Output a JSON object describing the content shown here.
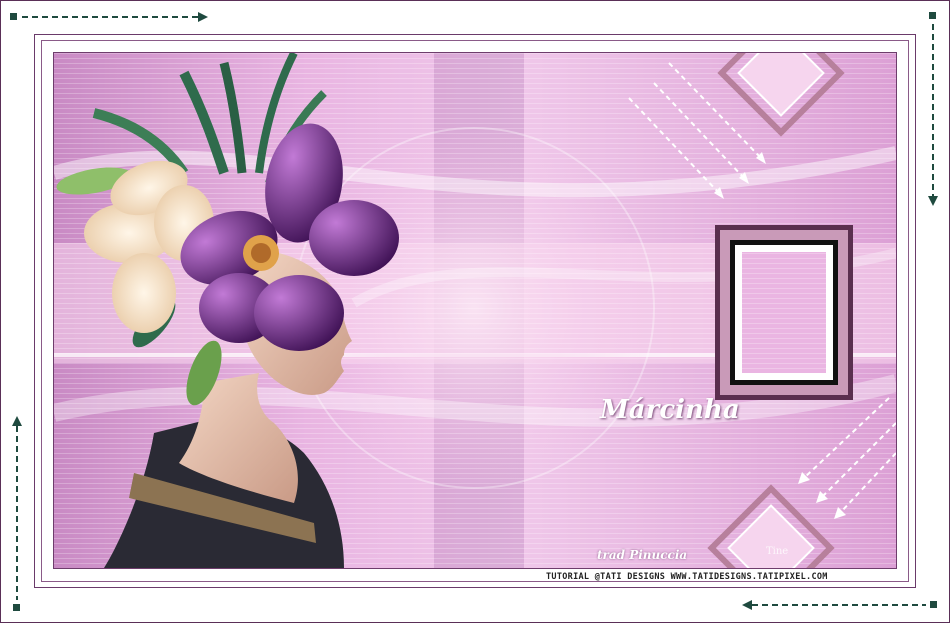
{
  "artwork": {
    "name_title": "Márcinha",
    "credit_text": "trad Pinuccia",
    "tutorial_credit": "TUTORIAL @TATI DESIGNS WWW.TATIDESIGNS.TATIPIXEL.COM",
    "signature": "Tine"
  },
  "colors": {
    "frame": "#5a2f57",
    "pink_main": "#e5a3df",
    "pink_light": "#f4d6f0",
    "purple_deep": "#7a3d8e",
    "arrow_dark": "#1f4a3f"
  }
}
